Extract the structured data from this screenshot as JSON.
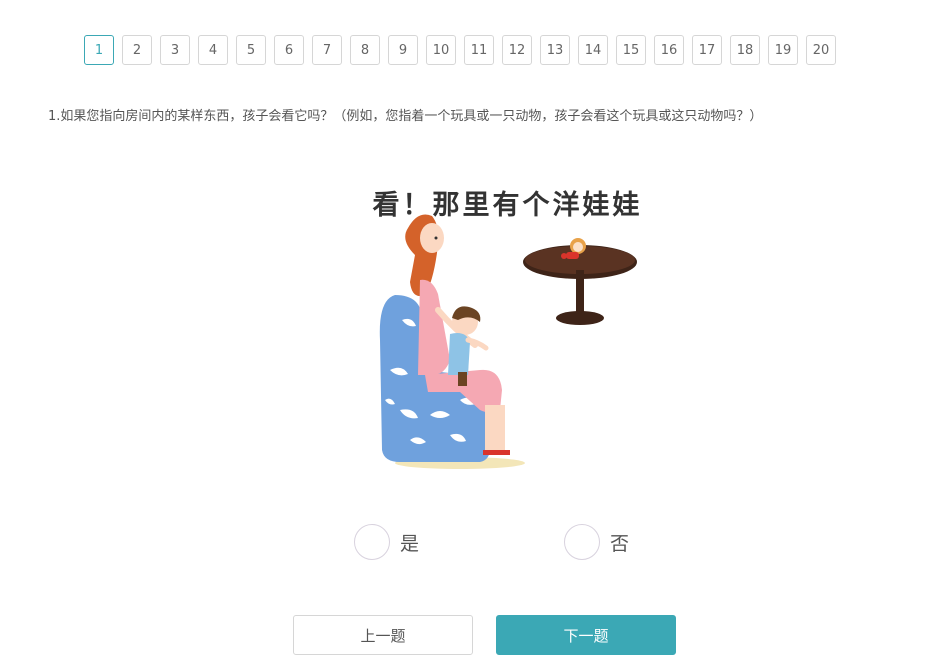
{
  "pager": {
    "pages": [
      "1",
      "2",
      "3",
      "4",
      "5",
      "6",
      "7",
      "8",
      "9",
      "10",
      "11",
      "12",
      "13",
      "14",
      "15",
      "16",
      "17",
      "18",
      "19",
      "20"
    ],
    "active": "1"
  },
  "question": {
    "text": "1.如果您指向房间内的某样东西，孩子会看它吗？（例如，您指着一个玩具或一只动物，孩子会看这个玩具或这只动物吗？）"
  },
  "illustration": {
    "caption": "看！那里有个洋娃娃",
    "description_icons": [
      "mother-icon",
      "child-icon",
      "armchair-icon",
      "table-icon",
      "doll-icon"
    ]
  },
  "options": [
    {
      "label": "是"
    },
    {
      "label": "否"
    }
  ],
  "buttons": {
    "prev_label": "上一题",
    "next_label": "下一题"
  },
  "colors": {
    "accent": "#3ba8b5",
    "chair_blue": "#6fa1dd",
    "hair": "#d4622a",
    "table": "#3e2418"
  }
}
